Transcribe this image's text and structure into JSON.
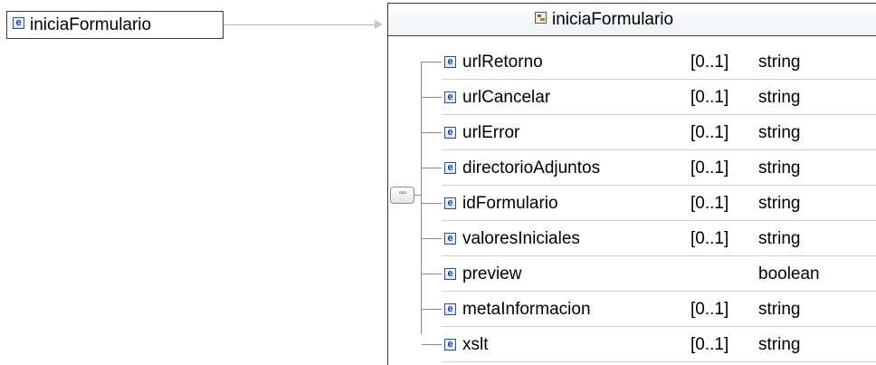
{
  "root_element": {
    "icon": "element-icon",
    "icon_glyph": "e",
    "name": "iniciaFormulario"
  },
  "complex_type": {
    "icon": "complex-type-icon",
    "name": "iniciaFormulario"
  },
  "sequence": {
    "icon": "sequence-compositor-icon",
    "glyph": "▫▫▫"
  },
  "elements": [
    {
      "name": "urlRetorno",
      "cardinality": "[0..1]",
      "type": "string"
    },
    {
      "name": "urlCancelar",
      "cardinality": "[0..1]",
      "type": "string"
    },
    {
      "name": "urlError",
      "cardinality": "[0..1]",
      "type": "string"
    },
    {
      "name": "directorioAdjuntos",
      "cardinality": "[0..1]",
      "type": "string"
    },
    {
      "name": "idFormulario",
      "cardinality": "[0..1]",
      "type": "string"
    },
    {
      "name": "valoresIniciales",
      "cardinality": "[0..1]",
      "type": "string"
    },
    {
      "name": "preview",
      "cardinality": "",
      "type": "boolean"
    },
    {
      "name": "metaInformacion",
      "cardinality": "[0..1]",
      "type": "string"
    },
    {
      "name": "xslt",
      "cardinality": "[0..1]",
      "type": "string"
    }
  ]
}
